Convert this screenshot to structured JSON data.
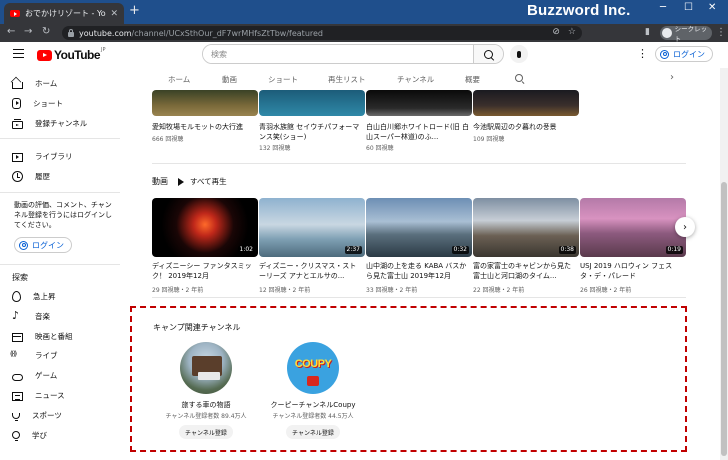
{
  "browser": {
    "tab_title": "おでかけリゾート - YouTube",
    "brand": "Buzzword Inc.",
    "url_host": "youtube.com",
    "url_path": "/channel/UCxSthOur_dF7wrMHfsZtTbw/featured",
    "profile_label": "シークレット"
  },
  "masthead": {
    "logo_text": "YouTube",
    "logo_region": "JP",
    "search_placeholder": "検索",
    "login_label": "ログイン"
  },
  "sidebar": {
    "items": [
      {
        "label": "ホーム",
        "icon": "home-icon"
      },
      {
        "label": "ショート",
        "icon": "shorts-icon"
      },
      {
        "label": "登録チャンネル",
        "icon": "subscriptions-icon"
      },
      {
        "label": "ライブラリ",
        "icon": "library-icon"
      },
      {
        "label": "履歴",
        "icon": "history-icon"
      }
    ],
    "promo_text": "動画の評価、コメント、チャンネル登録を行うにはログインしてください。",
    "login_label": "ログイン",
    "explore_heading": "探索",
    "explore_items": [
      {
        "label": "急上昇",
        "icon": "trending-icon"
      },
      {
        "label": "音楽",
        "icon": "music-icon"
      },
      {
        "label": "映画と番組",
        "icon": "movie-icon"
      },
      {
        "label": "ライブ",
        "icon": "live-icon"
      },
      {
        "label": "ゲーム",
        "icon": "gaming-icon"
      },
      {
        "label": "ニュース",
        "icon": "news-icon"
      },
      {
        "label": "スポーツ",
        "icon": "sports-icon"
      },
      {
        "label": "学び",
        "icon": "learning-icon"
      }
    ]
  },
  "channel_tabs": [
    "ホーム",
    "動画",
    "ショート",
    "再生リスト",
    "チャンネル",
    "概要"
  ],
  "top_row": [
    {
      "title": "愛知牧場モルモットの大行進",
      "meta": "666 回視聴"
    },
    {
      "title": "青羽水族館 セイウチパフォーマンス笑(ショー)",
      "meta": "132 回視聴"
    },
    {
      "title": "白山白川郷ホワイトロード(旧 白山スーパー林道)のふ...",
      "meta": "60 回視聴"
    },
    {
      "title": "今池駅周辺の夕暮れの풍景",
      "meta": "109 回視聴"
    }
  ],
  "videos_section": {
    "title": "動画",
    "play_all": "すべて再生",
    "videos": [
      {
        "title": "ディズニーシー ファンタスミック！ 2019年12月",
        "meta": "29 回視聴・2 年前",
        "duration": "1:02"
      },
      {
        "title": "ディズニー・クリスマス・ストーリーズ アナとエルサの...",
        "meta": "12 回視聴・2 年前",
        "duration": "2:37"
      },
      {
        "title": "山中湖の上を走る KABA バスから見た富士山 2019年12月",
        "meta": "33 回視聴・2 年前",
        "duration": "0:32"
      },
      {
        "title": "富の家富士のキャビンから見た富士山と河口湖のタイム...",
        "meta": "22 回視聴・2 年前",
        "duration": "0:38"
      },
      {
        "title": "USJ 2019 ハロウィン フェスタ・デ・パレード",
        "meta": "26 回視聴・2 年前",
        "duration": "0:19"
      }
    ]
  },
  "featured": {
    "title": "キャンプ関連チャンネル",
    "channels": [
      {
        "name": "旅する車の物語",
        "subs": "チャンネル登録者数 89.4万人",
        "button": "チャンネル登録"
      },
      {
        "name": "クーピーチャンネルCoupy",
        "subs": "チャンネル登録者数 44.5万人",
        "button": "チャンネル登録",
        "logo_text": "COUPY"
      }
    ]
  },
  "colors": {
    "accent_red": "#ff0000",
    "link_blue": "#065fd4",
    "highlight_dash": "#c00000",
    "tab_strip": "#1f4f8c"
  }
}
